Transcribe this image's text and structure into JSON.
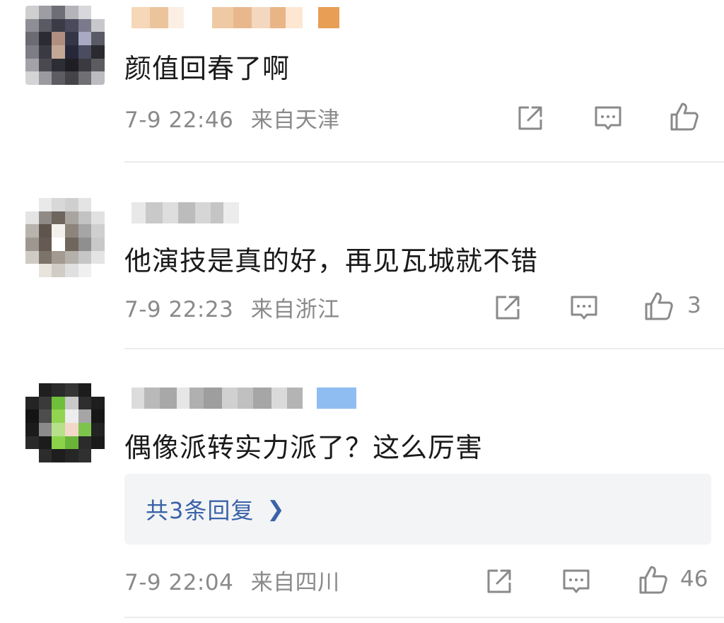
{
  "comments": [
    {
      "text": "颜值回春了啊",
      "time": "7-9 22:46",
      "location": "来自天津",
      "like_count": ""
    },
    {
      "text": "他演技是真的好，再见瓦城就不错",
      "time": "7-9 22:23",
      "location": "来自浙江",
      "like_count": "3"
    },
    {
      "text": "偶像派转实力派了？这么厉害",
      "time": "7-9 22:04",
      "location": "来自四川",
      "like_count": "46",
      "replies_label": "共3条回复"
    }
  ],
  "icons": {
    "share": "share-icon",
    "comment": "comment-icon",
    "like": "thumbs-up-icon",
    "chevron": "chevron-right-icon"
  },
  "colors": {
    "text": "#1a1a1a",
    "meta": "#8a8a8a",
    "link": "#3a63a8",
    "reply_bg": "#f3f4f6"
  }
}
